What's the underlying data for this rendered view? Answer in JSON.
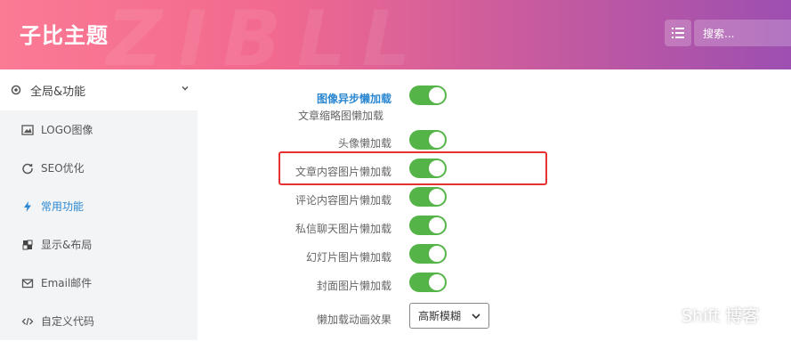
{
  "header": {
    "brand": "子比主题",
    "watermark_text": "ZIBLL",
    "search_placeholder": "搜索..."
  },
  "sidebar": {
    "group": {
      "label": "全局&功能",
      "icon": "gear-icon"
    },
    "items": [
      {
        "label": "LOGO图像",
        "icon": "image-icon",
        "active": false
      },
      {
        "label": "SEO优化",
        "icon": "refresh-icon",
        "active": false
      },
      {
        "label": "常用功能",
        "icon": "bolt-icon",
        "active": true
      },
      {
        "label": "显示&布局",
        "icon": "layout-icon",
        "active": false
      },
      {
        "label": "Email邮件",
        "icon": "mail-icon",
        "active": false
      },
      {
        "label": "自定义代码",
        "icon": "code-icon",
        "active": false
      }
    ]
  },
  "settings": {
    "section_title": "图像异步懒加载",
    "section_sub": "文章缩略图懒加载",
    "rows": [
      {
        "label": "头像懒加载",
        "on": true
      },
      {
        "label": "文章内容图片懒加载",
        "on": true
      },
      {
        "label": "评论内容图片懒加载",
        "on": true
      },
      {
        "label": "私信聊天图片懒加载",
        "on": true
      },
      {
        "label": "幻灯片图片懒加载",
        "on": true
      },
      {
        "label": "封面图片懒加载",
        "on": true
      }
    ],
    "effect_label": "懒加载动画效果",
    "effect_value": "高斯模糊"
  },
  "colors": {
    "toggle_on": "#54b448",
    "accent": "#2b87d1",
    "highlight_box": "#e53333"
  },
  "overlay": {
    "watermark": "Shift 博客"
  }
}
